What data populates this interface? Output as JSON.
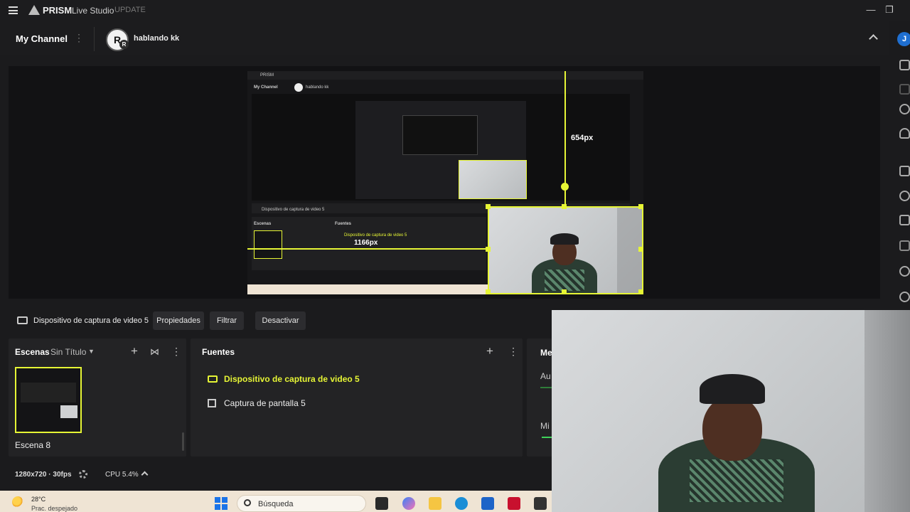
{
  "app": {
    "name": "PRISM",
    "subtitle": "Live Studio",
    "update_label": "UPDATE"
  },
  "channel": {
    "label": "My Channel",
    "avatar_letter": "R",
    "avatar_badge": "R",
    "name": "hablando kk",
    "user_initial": "J"
  },
  "preview": {
    "height_label": "654px",
    "width_label": "1166px"
  },
  "source_toolbar": {
    "source_name": "Dispositivo de captura de video 5",
    "properties": "Propiedades",
    "filter": "Filtrar",
    "deactivate": "Desactivar"
  },
  "scenes": {
    "title": "Escenas",
    "collection": "Sin Título",
    "items": [
      {
        "label": "Escena 8"
      }
    ]
  },
  "sources": {
    "title": "Fuentes",
    "items": [
      {
        "label": "Dispositivo de captura de video 5",
        "icon": "camera-icon",
        "selected": true
      },
      {
        "label": "Captura de pantalla 5",
        "icon": "screen-capture-icon",
        "selected": false
      }
    ]
  },
  "mixer": {
    "title": "Me",
    "channels": [
      {
        "label": "Au"
      },
      {
        "label": "Mi"
      }
    ]
  },
  "status": {
    "resolution": "1280x720 · 30fps",
    "cpu": "CPU 5.4%"
  },
  "taskbar": {
    "temperature": "28°C",
    "weather": "Prac. despejado",
    "search_placeholder": "Búsqueda"
  },
  "colors": {
    "accent": "#e6f535",
    "background": "#1b1b1d",
    "panel": "#232325"
  }
}
